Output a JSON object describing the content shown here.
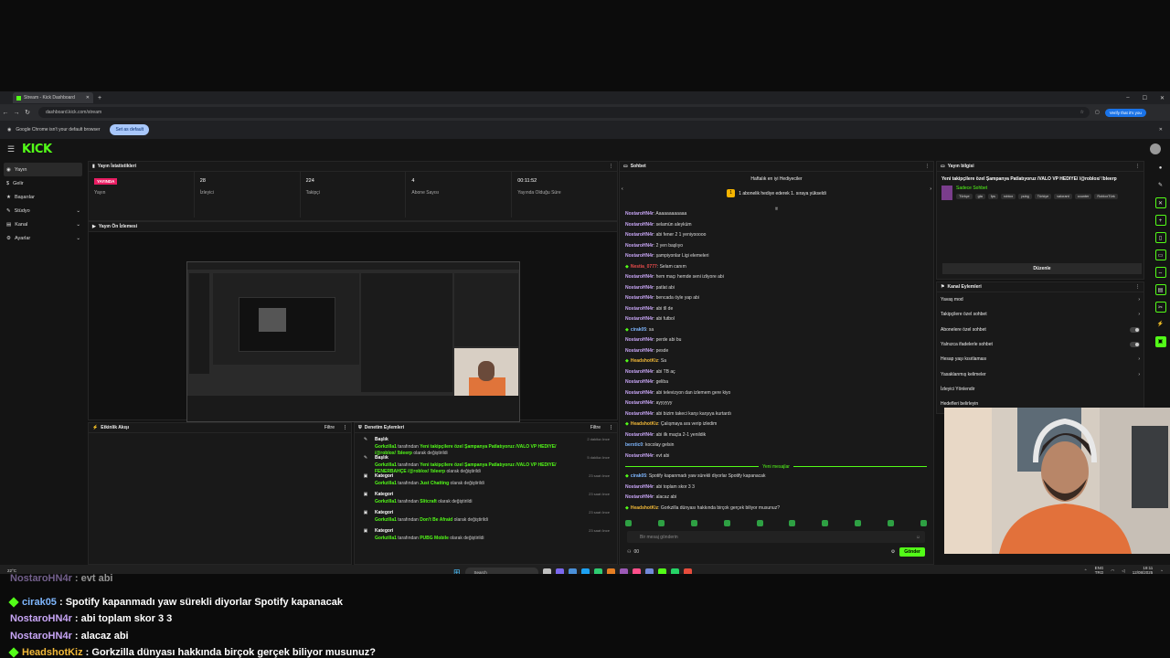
{
  "browser": {
    "tab_title": "Stream - Kick Dashboard",
    "url": "dashboard.kick.com/stream",
    "verify_label": "Verify that it's you",
    "infobar_text": "Google Chrome isn't your default browser",
    "set_default_label": "Set as default"
  },
  "app": {
    "logo": "KICK"
  },
  "sidebar": {
    "items": [
      {
        "label": "Yayın",
        "icon": "broadcast-icon",
        "active": true
      },
      {
        "label": "Gelir",
        "icon": "revenue-icon"
      },
      {
        "label": "Başarılar",
        "icon": "achievements-icon"
      },
      {
        "label": "Stüdyo",
        "icon": "studio-icon",
        "expandable": true
      },
      {
        "label": "Kanal",
        "icon": "channel-icon",
        "expandable": true
      },
      {
        "label": "Ayarlar",
        "icon": "settings-icon",
        "expandable": true
      }
    ]
  },
  "stats": {
    "title": "Yayın İstatistikleri",
    "live_badge": "YAYINDA",
    "live_label": "Yayın",
    "viewers": "28",
    "viewers_label": "İzleyici",
    "followers": "224",
    "followers_label": "Takipçi",
    "subs": "4",
    "subs_label": "Abone Sayısı",
    "uptime": "00:11:52",
    "uptime_label": "Yayında Olduğu Süre"
  },
  "preview": {
    "title": "Yayın Ön İzlemesi"
  },
  "activity": {
    "title": "Etkinlik Akışı",
    "filter": "Filtre"
  },
  "mod": {
    "title": "Denetim Eylemleri",
    "filter": "Filtre",
    "items": [
      {
        "type": "Başlık",
        "user": "Gorkzilla1",
        "pre": " tarafından ",
        "value": "Yeni takipçilere özel Şampanya Patlatıyoruz /VALO VP HEDIYE/ /@roblox/ !bleerp",
        "post": " olarak değiştirildi",
        "time": "2 dakika önce"
      },
      {
        "type": "Başlık",
        "user": "Gorkzilla1",
        "pre": " tarafından ",
        "value": "Yeni takipçilere özel Şampanya Patlatıyoruz /VALO VP HEDIYE/ FENERBAHÇE /@roblox/ !bleerp",
        "post": " olarak değiştirildi",
        "time": "5 dakika önce"
      },
      {
        "type": "Kategori",
        "user": "Gorkzilla1",
        "pre": " tarafından ",
        "value": "Just Chatting",
        "post": " olarak değiştirildi",
        "time": "23 saat önce"
      },
      {
        "type": "Kategori",
        "user": "Gorkzilla1",
        "pre": " tarafından ",
        "value": "Slitcraft",
        "post": " olarak değiştirildi",
        "time": "23 saat önce"
      },
      {
        "type": "Kategori",
        "user": "Gorkzilla1",
        "pre": " tarafından ",
        "value": "Don't Be Afraid",
        "post": " olarak değiştirildi",
        "time": "23 saat önce"
      },
      {
        "type": "Kategori",
        "user": "Gorkzilla1",
        "pre": " tarafından ",
        "value": "PUBG Mobile",
        "post": " olarak değiştirildi",
        "time": "23 saat önce"
      }
    ]
  },
  "chat": {
    "title": "Sohbet",
    "weekly_title": "Haftalık en iyi Hediyeciler",
    "gift_text": "1 abonelik hediye ederek 1. sıraya yükseldi",
    "messages": [
      {
        "name": "NostaroHN4r",
        "color": "#c7a5f5",
        "text": "Aaaaaaaaaaaa"
      },
      {
        "name": "NostaroHN4r",
        "color": "#c7a5f5",
        "text": "selamün aleyküm"
      },
      {
        "name": "NostaroHN4r",
        "color": "#c7a5f5",
        "text": "abi fener 2 1 yeniyooooo"
      },
      {
        "name": "NostaroHN4r",
        "color": "#c7a5f5",
        "text": "2 yen başlıyo"
      },
      {
        "name": "NostaroHN4r",
        "color": "#c7a5f5",
        "text": "şampiyonlar Ligi elemeleri"
      },
      {
        "name": "Nestia_0777",
        "color": "#e94c4c",
        "text": "Selam canım",
        "badge": true
      },
      {
        "name": "NostaroHN4r",
        "color": "#c7a5f5",
        "text": "hem maçı hemde seni izliyore abi"
      },
      {
        "name": "NostaroHN4r",
        "color": "#c7a5f5",
        "text": "patlat abi"
      },
      {
        "name": "NostaroHN4r",
        "color": "#c7a5f5",
        "text": "bencada öyle yap abi"
      },
      {
        "name": "NostaroHN4r",
        "color": "#c7a5f5",
        "text": "abi tll de"
      },
      {
        "name": "NostaroHN4r",
        "color": "#c7a5f5",
        "text": "abi futbol"
      },
      {
        "name": "cirak05",
        "color": "#7fb7ff",
        "text": "sa",
        "badge": true
      },
      {
        "name": "NostaroHN4r",
        "color": "#c7a5f5",
        "text": "perde abi bu"
      },
      {
        "name": "NostaroHN4r",
        "color": "#c7a5f5",
        "text": "pesde"
      },
      {
        "name": "HeadshotKiz",
        "color": "#f2b938",
        "text": "Sa",
        "badge": true
      },
      {
        "name": "NostaroHN4r",
        "color": "#c7a5f5",
        "text": "abi TB aç"
      },
      {
        "name": "NostaroHN4r",
        "color": "#c7a5f5",
        "text": "geliba"
      },
      {
        "name": "NostaroHN4r",
        "color": "#c7a5f5",
        "text": "abi televizyon dan izlemem gere kiyo"
      },
      {
        "name": "NostaroHN4r",
        "color": "#c7a5f5",
        "text": "ayyyyyy"
      },
      {
        "name": "NostaroHN4r",
        "color": "#c7a5f5",
        "text": "abi bizim takeci karşı karşıya kurtardı"
      },
      {
        "name": "HeadshotKiz",
        "color": "#f2b938",
        "text": "Çalışmaya ara verip izledim",
        "badge": true
      },
      {
        "name": "NostaroHN4r",
        "color": "#c7a5f5",
        "text": "abi ilk maçta 2-1 yenildik"
      },
      {
        "name": "berxtic0",
        "color": "#7fb7ff",
        "text": "kocolay gelsin"
      },
      {
        "name": "NostaroHN4r",
        "color": "#c7a5f5",
        "text": "evt abi"
      }
    ],
    "new_label": "Yeni mesajlar",
    "new_messages": [
      {
        "name": "cirak05",
        "color": "#7fb7ff",
        "text": "Spotify kapanmadı yaw sürekli diyorlar Spotify kapanacak",
        "badge": true
      },
      {
        "name": "NostaroHN4r",
        "color": "#c7a5f5",
        "text": "abi toplam skor 3 3"
      },
      {
        "name": "NostaroHN4r",
        "color": "#c7a5f5",
        "text": "alacaz abi"
      },
      {
        "name": "HeadshotKiz",
        "color": "#f2b938",
        "text": "Gorkzilla dünyası hakkında birçok gerçek biliyor musunuz?",
        "badge": true
      }
    ],
    "input_placeholder": "Bir mesaj gönderin",
    "viewers_icon_count": "00",
    "send_label": "Gönder"
  },
  "info": {
    "title": "Yayın bilgisi",
    "stream_title": "Yeni takipçilere özel Şampanya Patlatıyoruz /VALO VP HEDIYE/ /@roblox/ !bleerp",
    "category": "Sadece Sohbet",
    "tags": [
      "Türkçe",
      "gta",
      "fps",
      "roblox",
      "pubg",
      "Türkiye",
      "valorant",
      "counter",
      "RobloxTürk"
    ],
    "edit_label": "Düzenle"
  },
  "actions": {
    "title": "Kanal Eylemleri",
    "items": [
      {
        "label": "Yavaş mod",
        "control": "chevron"
      },
      {
        "label": "Takipçilere özel sohbet",
        "control": "chevron"
      },
      {
        "label": "Abonelere özel sohbet",
        "control": "toggle"
      },
      {
        "label": "Yalnızca ifadelerle sohbet",
        "control": "toggle"
      },
      {
        "label": "Hesap yaşı kısıtlaması",
        "control": "chevron"
      },
      {
        "label": "Yasaklanmış kelimeler",
        "control": "chevron"
      },
      {
        "label": "İzleyici Yönlendir",
        "control": "none"
      },
      {
        "label": "Hedefleri belirleyin",
        "control": "none"
      }
    ]
  },
  "taskbar": {
    "weather_temp": "22°C",
    "weather_desc": "Sunny",
    "search": "Search",
    "lang": "ENG",
    "region": "TRQ",
    "time": "19:11",
    "date": "12/08/2025"
  },
  "overlay": [
    {
      "name": "NostaroHN4r",
      "text": " : evt abi",
      "color": "#c7a5f5"
    },
    {
      "name": "cirak05",
      "text": " : Spotify kapanmadı yaw sürekli diyorlar Spotify kapanacak",
      "color": "#7fb7ff",
      "badge": true
    },
    {
      "name": "NostaroHN4r",
      "text": " : abi toplam skor 3 3",
      "color": "#c7a5f5"
    },
    {
      "name": "NostaroHN4r",
      "text": " : alacaz abi",
      "color": "#c7a5f5"
    },
    {
      "name": "HeadshotKiz",
      "text": " : Gorkzilla dünyası hakkında birçok gerçek biliyor musunuz?",
      "color": "#f2b938",
      "badge": true
    }
  ]
}
